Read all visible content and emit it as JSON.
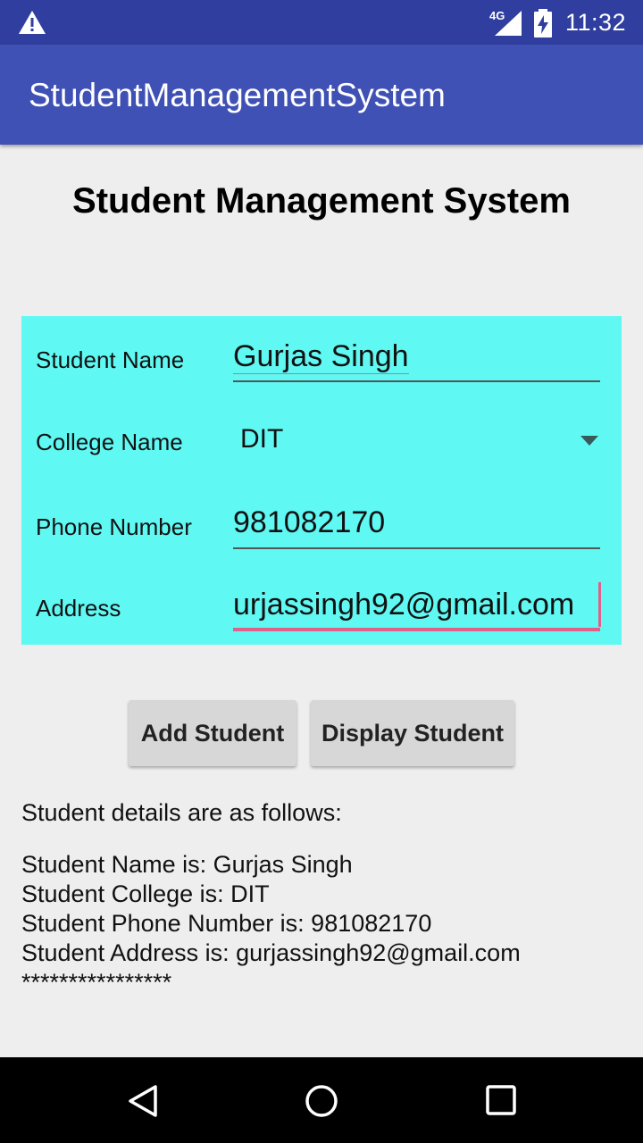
{
  "status_bar": {
    "network": "4G",
    "time": "11:32",
    "icons": [
      "warning-icon",
      "signal-icon",
      "battery-charging-icon"
    ]
  },
  "app_bar": {
    "title": "StudentManagementSystem"
  },
  "page": {
    "heading": "Student Management System"
  },
  "form": {
    "student_name": {
      "label": "Student Name",
      "value": "Gurjas Singh"
    },
    "college_name": {
      "label": "College Name",
      "selected": "DIT"
    },
    "phone_number": {
      "label": "Phone Number",
      "value": "981082170"
    },
    "address": {
      "label": "Address",
      "value": "urjassingh92@gmail.com"
    }
  },
  "buttons": {
    "add": "Add Student",
    "display": "Display Student"
  },
  "details": {
    "heading": "Student details are as follows:",
    "lines": [
      "Student Name is: Gurjas Singh",
      "Student College is: DIT",
      "Student Phone Number is: 981082170",
      "Student Address is: gurjassingh92@gmail.com",
      "****************"
    ]
  },
  "colors": {
    "status_bar": "#303f9f",
    "app_bar": "#3f51b5",
    "form_panel": "#60f8f3",
    "spell_underline": "#e06a80"
  },
  "nav_bar": {
    "icons": [
      "back-icon",
      "home-icon",
      "recents-icon"
    ]
  }
}
